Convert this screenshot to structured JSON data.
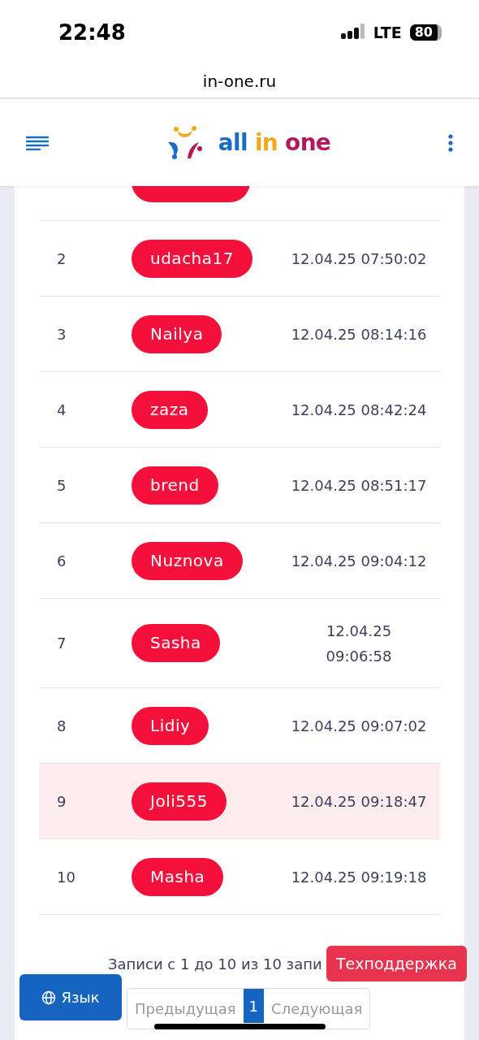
{
  "status_bar": {
    "time": "22:48",
    "network": "LTE",
    "battery": "80"
  },
  "address_bar": {
    "url": "in-one.ru"
  },
  "header": {
    "logo_words": [
      "all",
      "in",
      "one"
    ]
  },
  "table": {
    "rows": [
      {
        "index": "2",
        "name": "udacha17",
        "time": "12.04.25 07:50:02",
        "selected": false
      },
      {
        "index": "3",
        "name": "Nailya",
        "time": "12.04.25 08:14:16",
        "selected": false
      },
      {
        "index": "4",
        "name": "zaza",
        "time": "12.04.25 08:42:24",
        "selected": false
      },
      {
        "index": "5",
        "name": "brend",
        "time": "12.04.25 08:51:17",
        "selected": false
      },
      {
        "index": "6",
        "name": "Nuznova",
        "time": "12.04.25 09:04:12",
        "selected": false
      },
      {
        "index": "7",
        "name": "Sasha",
        "time": "12.04.25 09:06:58",
        "selected": false
      },
      {
        "index": "8",
        "name": "Lidiy",
        "time": "12.04.25 09:07:02",
        "selected": false
      },
      {
        "index": "9",
        "name": "Joli555",
        "time": "12.04.25 09:18:47",
        "selected": true
      },
      {
        "index": "10",
        "name": "Masha",
        "time": "12.04.25 09:19:18",
        "selected": false
      }
    ]
  },
  "table_info": "Записи с 1 до 10 из 10 запи",
  "pagination": {
    "previous": {
      "label": "Предыдущая",
      "disabled": true
    },
    "pages": [
      {
        "label": "1",
        "selected": true
      }
    ],
    "next": {
      "label": "Следующая",
      "disabled": true
    }
  },
  "support_button": "Техподдержка",
  "language_button": "Язык"
}
